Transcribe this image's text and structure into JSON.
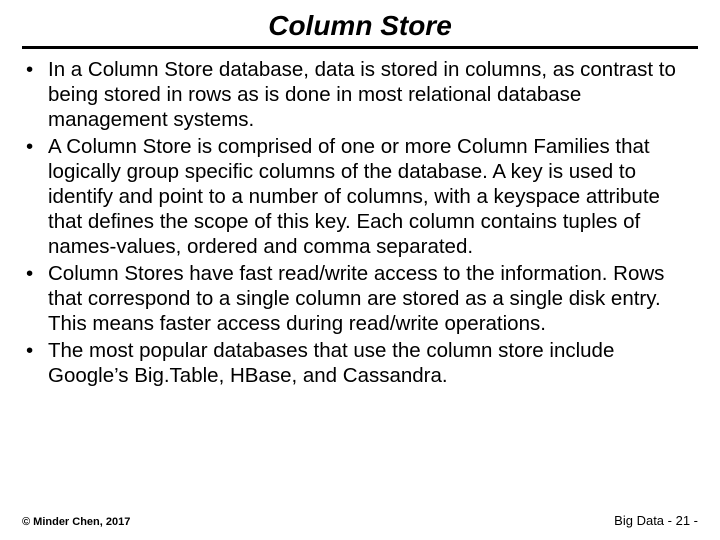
{
  "title": "Column Store",
  "bullets": [
    "In a Column Store database, data is stored in columns, as contrast to being stored in rows as is done in most relational database management systems.",
    "A Column Store is comprised of one or more Column Families that logically group specific columns of the database. A key is used to identify and point to a number of columns, with a keyspace attribute that defines the scope of this key. Each column contains tuples of names-values, ordered and comma separated.",
    "Column Stores have fast read/write access to the information. Rows that correspond to a single column are stored as a single disk entry. This means faster access during read/write operations.",
    "The most popular databases that use the column store include Google’s Big.Table, HBase, and Cassandra."
  ],
  "footer": {
    "copyright": "© Minder Chen, 2017",
    "page": "Big Data - 21 -"
  }
}
